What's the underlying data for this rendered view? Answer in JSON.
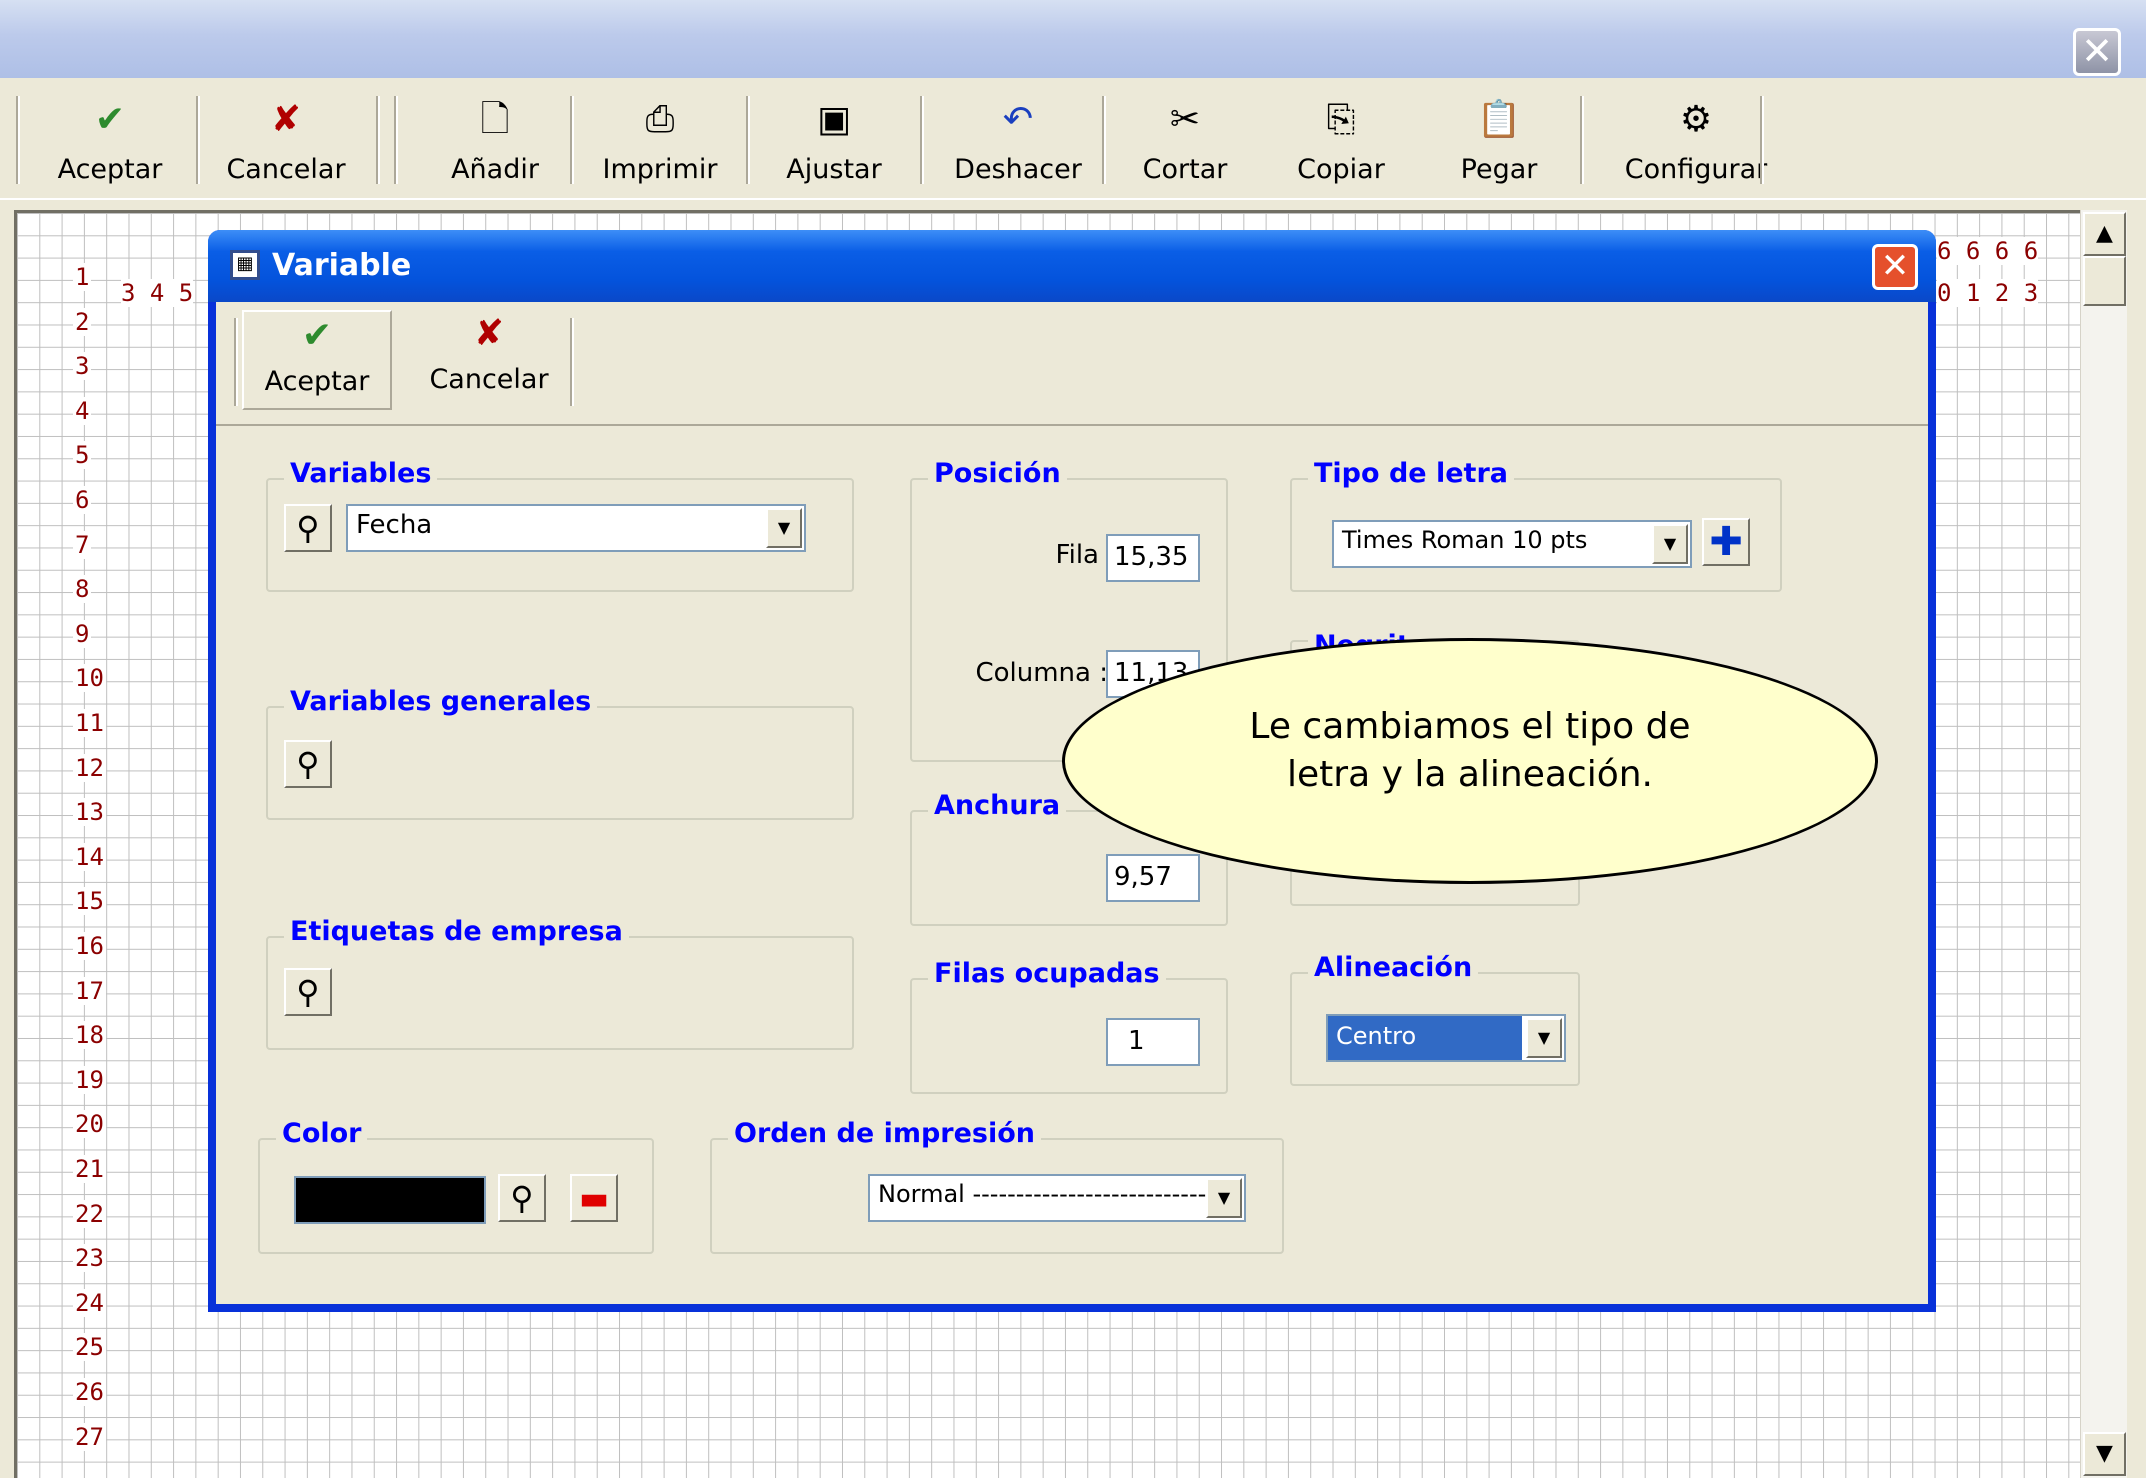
{
  "window": {
    "close_glyph": "✕"
  },
  "toolbar": {
    "buttons": [
      {
        "label": "Aceptar",
        "icon": "check-icon",
        "glyph": "✔",
        "color": "#2e8b2e"
      },
      {
        "label": "Cancelar",
        "icon": "x-icon",
        "glyph": "✘",
        "color": "#b00000"
      },
      {
        "label": "Añadir",
        "icon": "new-page-icon",
        "glyph": "🗋"
      },
      {
        "label": "Imprimir",
        "icon": "printer-icon",
        "glyph": "⎙"
      },
      {
        "label": "Ajustar",
        "icon": "monitor-icon",
        "glyph": "▣"
      },
      {
        "label": "Deshacer",
        "icon": "undo-icon",
        "glyph": "↶",
        "color": "#1a3fbf"
      },
      {
        "label": "Cortar",
        "icon": "scissors-icon",
        "glyph": "✂"
      },
      {
        "label": "Copiar",
        "icon": "copy-icon",
        "glyph": "⎘"
      },
      {
        "label": "Pegar",
        "icon": "paste-icon",
        "glyph": "📋"
      },
      {
        "label": "Configurar",
        "icon": "gear-icon",
        "glyph": "⚙"
      }
    ]
  },
  "grid": {
    "rows": [
      "1",
      "2",
      "3",
      "4",
      "5",
      "6",
      "7",
      "8",
      "9",
      "10",
      "11",
      "12",
      "13",
      "14",
      "15",
      "16",
      "17",
      "18",
      "19",
      "20",
      "21",
      "22",
      "23",
      "24",
      "25",
      "26",
      "27"
    ],
    "col_left": "3 4 5",
    "col_right_top": "6 6 6 6",
    "col_right_bottom": "0 1 2 3"
  },
  "dialog": {
    "title": "Variable",
    "toolbar": {
      "accept": "Aceptar",
      "cancel": "Cancelar"
    },
    "variables": {
      "legend": "Variables",
      "value": "Fecha"
    },
    "variables_generales": {
      "legend": "Variables generales"
    },
    "etiquetas": {
      "legend": "Etiquetas de empresa"
    },
    "color": {
      "legend": "Color",
      "swatch": "#000000"
    },
    "posicion": {
      "legend": "Posición",
      "fila_label": "Fila :",
      "fila_value": "15,35",
      "columna_label": "Columna :",
      "columna_value": "11,13"
    },
    "anchura": {
      "legend": "Anchura",
      "value": "9,57"
    },
    "filas": {
      "legend": "Filas ocupadas",
      "value": "1"
    },
    "orden": {
      "legend": "Orden de impresión",
      "value": "Normal ----------------------------"
    },
    "tipo_letra": {
      "legend": "Tipo de letra",
      "value": "Times Roman 10 pts"
    },
    "negrita": {
      "legend": "Negrit"
    },
    "alineacion": {
      "legend": "Alineación",
      "value": "Centro"
    }
  },
  "callout": {
    "line1": "Le cambiamos el tipo de",
    "line2": "letra y la alineación."
  }
}
